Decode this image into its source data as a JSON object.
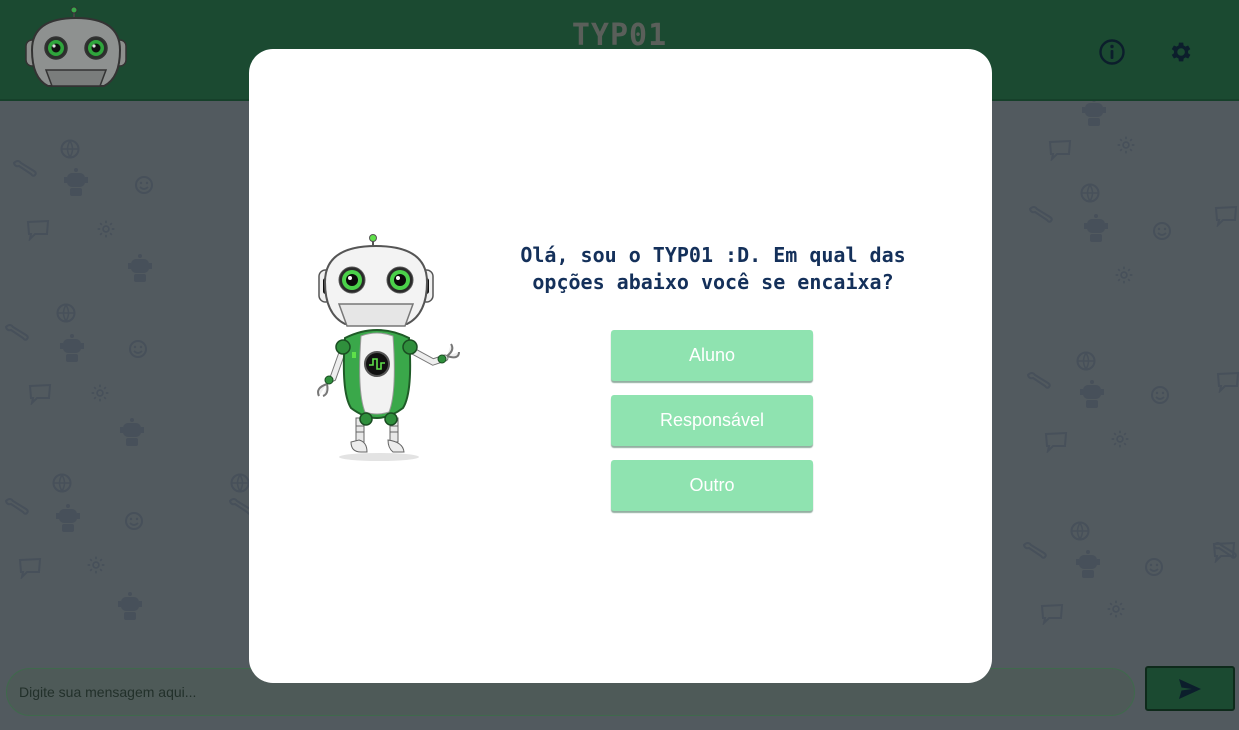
{
  "header": {
    "title": "TYP01",
    "info_icon": "info-circle-icon",
    "settings_icon": "gear-icon",
    "logo_icon": "robot-head-icon"
  },
  "modal": {
    "question": "Olá, sou o TYP01 :D. Em qual das opções abaixo você se encaixa?",
    "mascot_icon": "robot-mascot-icon",
    "options": [
      {
        "label": "Aluno"
      },
      {
        "label": "Responsável"
      },
      {
        "label": "Outro"
      }
    ]
  },
  "composer": {
    "placeholder": "Digite sua mensagem aqui...",
    "value": "",
    "send_icon": "send-icon"
  },
  "colors": {
    "header_bg": "#1b4a31",
    "overlay_bg": "#525a5f",
    "button_bg": "#8fe3b0",
    "question_text": "#14305a",
    "robot_green": "#3aa84a"
  }
}
